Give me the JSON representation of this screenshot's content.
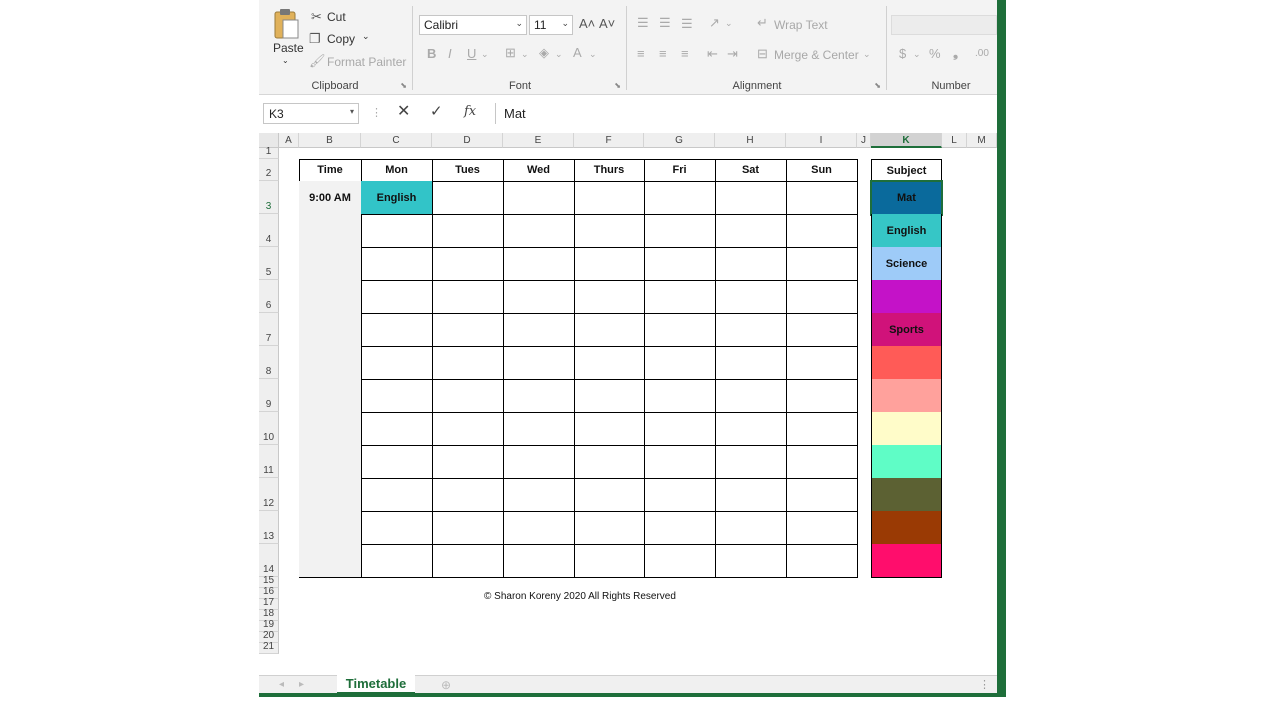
{
  "ribbon": {
    "clipboard": {
      "paste": "Paste",
      "cut": "Cut",
      "copy": "Copy",
      "format_painter": "Format Painter",
      "label": "Clipboard"
    },
    "font": {
      "family": "Calibri",
      "size": "11",
      "label": "Font"
    },
    "alignment": {
      "wrap_text": "Wrap Text",
      "merge_center": "Merge & Center",
      "label": "Alignment"
    },
    "number": {
      "label": "Number"
    }
  },
  "formula_bar": {
    "name_box": "K3",
    "fx": "fx",
    "value": "Mat"
  },
  "columns": [
    "A",
    "B",
    "C",
    "D",
    "E",
    "F",
    "G",
    "H",
    "I",
    "J",
    "K",
    "L",
    "M"
  ],
  "rows": [
    "1",
    "2",
    "3",
    "4",
    "5",
    "6",
    "7",
    "8",
    "9",
    "10",
    "11",
    "12",
    "13",
    "14",
    "15",
    "16",
    "17",
    "18",
    "19",
    "20",
    "21"
  ],
  "timetable": {
    "headers": [
      "Time",
      "Mon",
      "Tues",
      "Wed",
      "Thurs",
      "Fri",
      "Sat",
      "Sun"
    ],
    "first_row": {
      "time": "9:00 AM",
      "mon": "English"
    },
    "mon_color": "#32c4c8"
  },
  "subjects": {
    "header": "Subject",
    "items": [
      {
        "label": "Mat",
        "color": "#0a6a9c"
      },
      {
        "label": "English",
        "color": "#36c6c6"
      },
      {
        "label": "Science",
        "color": "#9ecbf8"
      },
      {
        "label": "",
        "color": "#c412c8"
      },
      {
        "label": "Sports",
        "color": "#d0127a"
      },
      {
        "label": "",
        "color": "#ff5b57"
      },
      {
        "label": "",
        "color": "#ffa19c"
      },
      {
        "label": "",
        "color": "#fffcc9"
      },
      {
        "label": "",
        "color": "#5ffdc6"
      },
      {
        "label": "",
        "color": "#5c6133"
      },
      {
        "label": "",
        "color": "#9a3a04"
      },
      {
        "label": "",
        "color": "#ff0d6c"
      }
    ]
  },
  "copyright": "© Sharon Koreny 2020 All Rights Reserved",
  "sheet_tab": "Timetable"
}
